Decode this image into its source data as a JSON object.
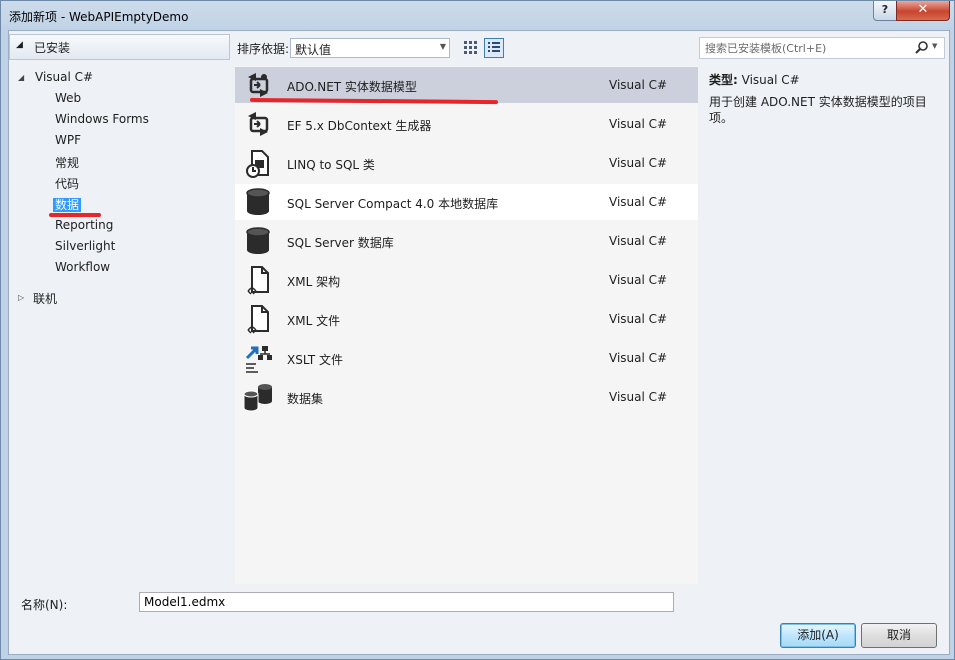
{
  "window": {
    "title": "添加新项 - WebAPIEmptyDemo",
    "help_label": "?",
    "close_label": "✕"
  },
  "left_panel": {
    "installed_label": "已安装",
    "tree": [
      {
        "label": "Visual C#",
        "expanded": true,
        "level": 0
      },
      {
        "label": "Web",
        "level": 1
      },
      {
        "label": "Windows Forms",
        "level": 1
      },
      {
        "label": "WPF",
        "level": 1
      },
      {
        "label": "常规",
        "level": 1
      },
      {
        "label": "代码",
        "level": 1
      },
      {
        "label": "数据",
        "level": 1,
        "selected": true
      },
      {
        "label": "Reporting",
        "level": 1
      },
      {
        "label": "Silverlight",
        "level": 1
      },
      {
        "label": "Workflow",
        "level": 1
      },
      {
        "label": "联机",
        "expanded": false,
        "level": 0
      }
    ]
  },
  "toolbar": {
    "sort_label": "排序依据:",
    "sort_value": "默认值"
  },
  "templates": [
    {
      "name": "ADO.NET 实体数据模型",
      "lang": "Visual C#",
      "icon": "entity-model-icon",
      "selected": true
    },
    {
      "name": "EF 5.x DbContext 生成器",
      "lang": "Visual C#",
      "icon": "dbcontext-generator-icon"
    },
    {
      "name": "LINQ to SQL 类",
      "lang": "Visual C#",
      "icon": "linq-to-sql-icon"
    },
    {
      "name": "SQL Server Compact 4.0 本地数据库",
      "lang": "Visual C#",
      "icon": "database-icon",
      "hover": true
    },
    {
      "name": "SQL Server 数据库",
      "lang": "Visual C#",
      "icon": "database-icon"
    },
    {
      "name": "XML 架构",
      "lang": "Visual C#",
      "icon": "xml-schema-icon"
    },
    {
      "name": "XML 文件",
      "lang": "Visual C#",
      "icon": "xml-file-icon"
    },
    {
      "name": "XSLT 文件",
      "lang": "Visual C#",
      "icon": "xslt-file-icon"
    },
    {
      "name": "数据集",
      "lang": "Visual C#",
      "icon": "dataset-icon"
    }
  ],
  "search": {
    "placeholder": "搜索已安装模板(Ctrl+E)"
  },
  "details": {
    "type_label": "类型:",
    "type_value": "Visual C#",
    "description": "用于创建 ADO.NET 实体数据模型的项目项。"
  },
  "bottom": {
    "name_label": "名称(N):",
    "name_value": "Model1.edmx",
    "add_label": "添加(A)",
    "cancel_label": "取消"
  }
}
